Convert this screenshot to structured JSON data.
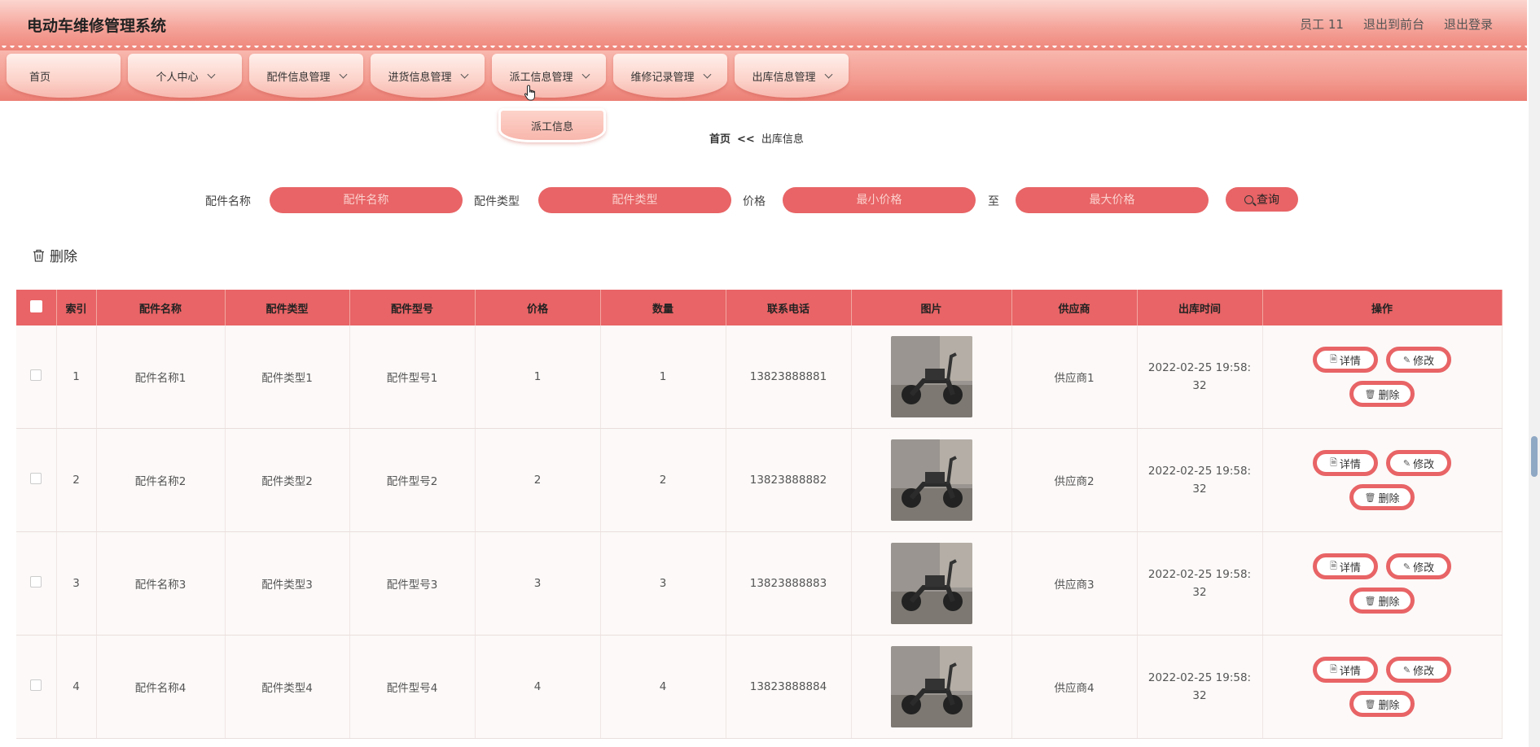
{
  "header": {
    "title": "电动车维修管理系统",
    "user": "员工 11",
    "to_front": "退出到前台",
    "logout": "退出登录"
  },
  "nav": {
    "items": [
      {
        "label": "首页"
      },
      {
        "label": "个人中心"
      },
      {
        "label": "配件信息管理"
      },
      {
        "label": "进货信息管理"
      },
      {
        "label": "派工信息管理"
      },
      {
        "label": "维修记录管理"
      },
      {
        "label": "出库信息管理"
      }
    ],
    "dropdown_item": "派工信息"
  },
  "breadcrumb": {
    "home": "首页",
    "sep": "<<",
    "current": "出库信息"
  },
  "search": {
    "name_label": "配件名称",
    "name_placeholder": "配件名称",
    "type_label": "配件类型",
    "type_placeholder": "配件类型",
    "price_label": "价格",
    "min_placeholder": "最小价格",
    "to_label": "至",
    "max_placeholder": "最大价格",
    "query_label": "查询"
  },
  "bulk_delete_label": "删除",
  "table": {
    "columns": [
      "索引",
      "配件名称",
      "配件类型",
      "配件型号",
      "价格",
      "数量",
      "联系电话",
      "图片",
      "供应商",
      "出库时间",
      "操作"
    ],
    "rows": [
      {
        "idx": "1",
        "name": "配件名称1",
        "type": "配件类型1",
        "model": "配件型号1",
        "price": "1",
        "qty": "1",
        "phone": "13823888881",
        "supplier": "供应商1",
        "time": "2022-02-25 19:58:32"
      },
      {
        "idx": "2",
        "name": "配件名称2",
        "type": "配件类型2",
        "model": "配件型号2",
        "price": "2",
        "qty": "2",
        "phone": "13823888882",
        "supplier": "供应商2",
        "time": "2022-02-25 19:58:32"
      },
      {
        "idx": "3",
        "name": "配件名称3",
        "type": "配件类型3",
        "model": "配件型号3",
        "price": "3",
        "qty": "3",
        "phone": "13823888883",
        "supplier": "供应商3",
        "time": "2022-02-25 19:58:32"
      },
      {
        "idx": "4",
        "name": "配件名称4",
        "type": "配件类型4",
        "model": "配件型号4",
        "price": "4",
        "qty": "4",
        "phone": "13823888884",
        "supplier": "供应商4",
        "time": "2022-02-25 19:58:32"
      }
    ],
    "actions": {
      "detail": "详情",
      "edit": "修改",
      "delete": "删除"
    }
  },
  "colors": {
    "accent": "#e86466",
    "header_top": "#fbd6cf",
    "header_bottom": "#ee8479"
  }
}
